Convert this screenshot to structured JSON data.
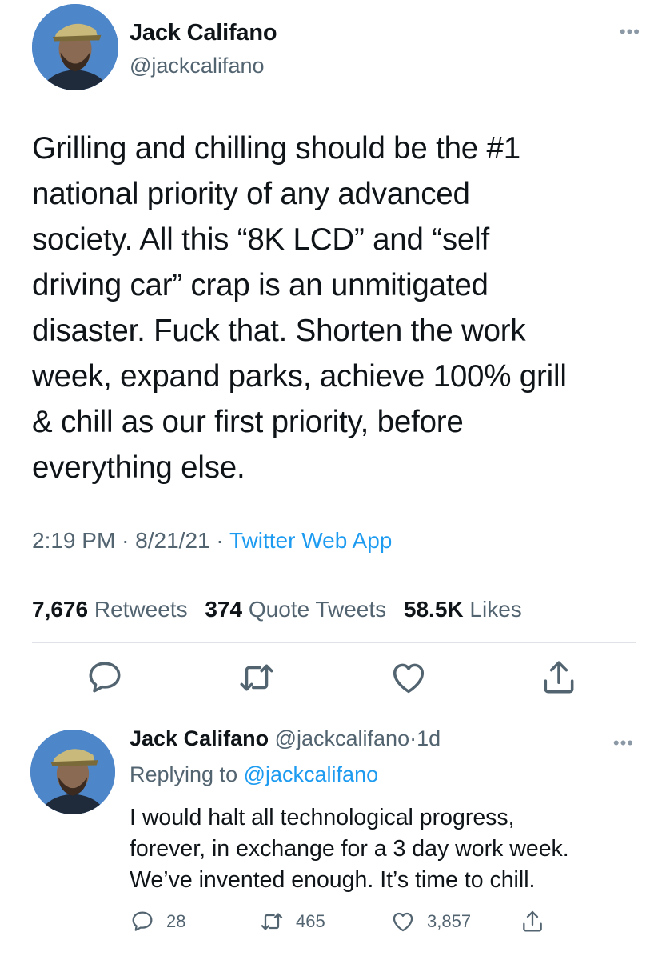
{
  "tweet": {
    "author_name": "Jack Califano",
    "author_handle": "@jackcalifano",
    "text": "Grilling and chilling should be the #1\nnational priority of any advanced\nsociety. All this “8K LCD” and “self\ndriving car” crap is an unmitigated\ndisaster. Fuck that. Shorten the work\nweek, expand parks, achieve 100% grill\n& chill as our first priority, before\neverything else.",
    "time": "2:19 PM",
    "date": "8/21/21",
    "separator": "·",
    "source": "Twitter Web App",
    "stats": {
      "retweets_count": "7,676",
      "retweets_label": "Retweets",
      "quotes_count": "374",
      "quotes_label": "Quote Tweets",
      "likes_count": "58.5K",
      "likes_label": "Likes"
    }
  },
  "reply": {
    "author_name": "Jack Califano",
    "author_handle": "@jackcalifano",
    "separator": "·",
    "age": "1d",
    "replying_to_label": "Replying to",
    "replying_to_handle": "@jackcalifano",
    "text": "I would halt all technological progress,\nforever, in exchange for a 3 day work week.\nWe’ve invented enough. It’s time to chill.",
    "reply_count": "28",
    "retweet_count": "465",
    "like_count": "3,857"
  },
  "icons": {
    "reply": "speech-bubble-icon",
    "retweet": "retweet-arrows-icon",
    "like": "heart-icon",
    "share": "share-upload-icon",
    "more": "ellipsis-icon"
  },
  "colors": {
    "text": "#0f1419",
    "secondary": "#536471",
    "link": "#1d9bf0",
    "divider": "#dfe3e7"
  }
}
